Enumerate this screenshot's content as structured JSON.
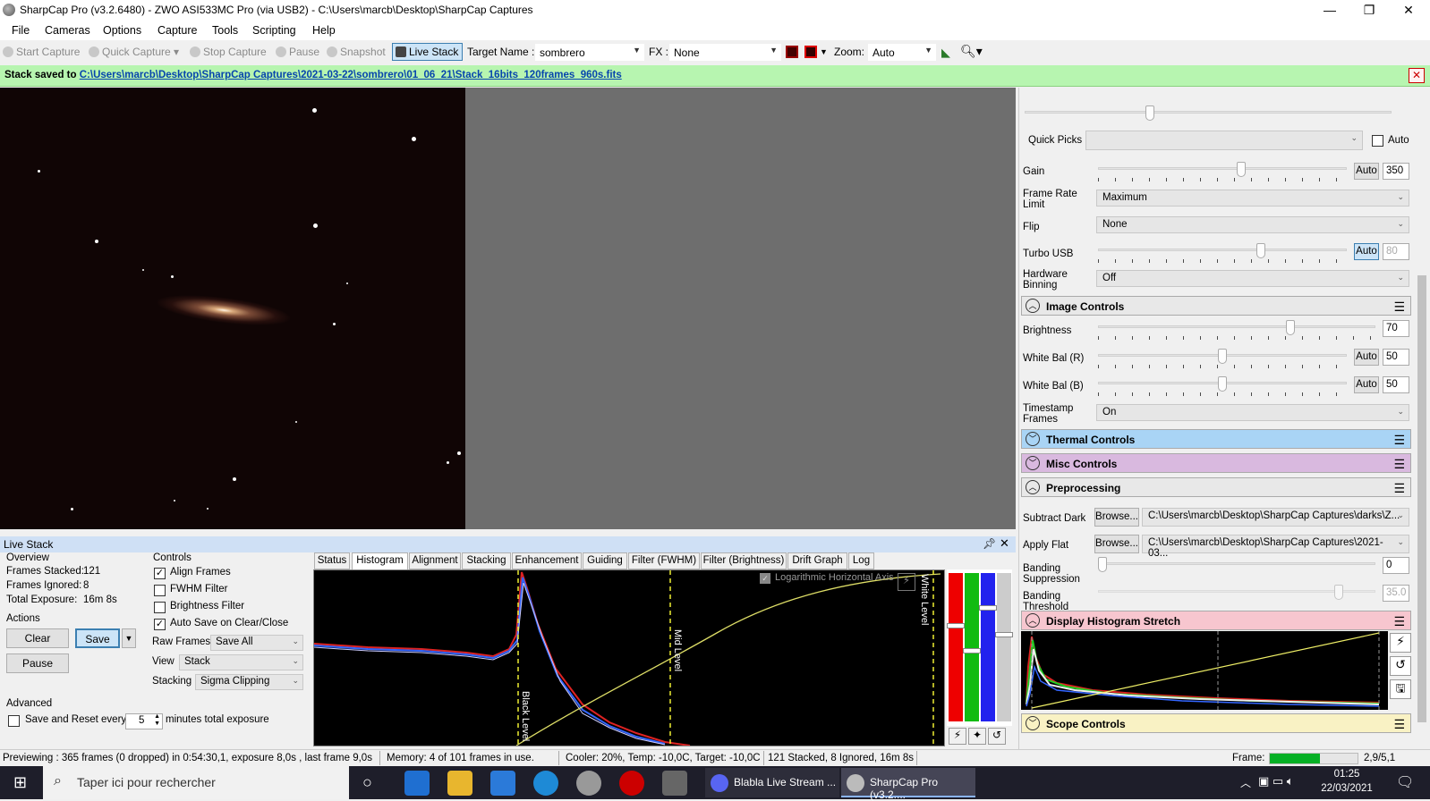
{
  "window": {
    "title": "SharpCap Pro (v3.2.6480) - ZWO ASI533MC Pro (via USB2) - C:\\Users\\marcb\\Desktop\\SharpCap Captures",
    "minimize": "—",
    "maximize": "❐",
    "close": "✕"
  },
  "menu": [
    "File",
    "Cameras",
    "Options",
    "Capture",
    "Tools",
    "Scripting",
    "Help"
  ],
  "toolbar": {
    "start_capture": "Start Capture",
    "quick_capture": "Quick Capture",
    "stop_capture": "Stop Capture",
    "pause": "Pause",
    "snapshot": "Snapshot",
    "live_stack": "Live Stack",
    "target_name_label": "Target Name :",
    "target_name_value": "sombrero",
    "fx_label": "FX :",
    "fx_value": "None",
    "zoom_label": "Zoom:",
    "zoom_value": "Auto"
  },
  "notification": {
    "prefix": "Stack saved to",
    "path": "C:\\Users\\marcb\\Desktop\\SharpCap Captures\\2021-03-22\\sombrero\\01_06_21\\Stack_16bits_120frames_960s.fits",
    "close": "✕"
  },
  "camera_controls": {
    "quick_picks_label": "Quick Picks",
    "quick_picks_value": "",
    "quick_picks_auto": "Auto",
    "gain_label": "Gain",
    "gain_auto": "Auto",
    "gain_value": "350",
    "gain_level": 0.58,
    "frame_rate_label": "Frame Rate Limit",
    "frame_rate_value": "Maximum",
    "flip_label": "Flip",
    "flip_value": "None",
    "turbo_label": "Turbo USB",
    "turbo_auto": "Auto",
    "turbo_value": "80",
    "turbo_level": 0.66,
    "binning_label": "Hardware Binning",
    "binning_value": "Off"
  },
  "image_controls": {
    "title": "Image Controls",
    "brightness_label": "Brightness",
    "brightness_value": "70",
    "brightness_level": 0.7,
    "wb_r_label": "White Bal (R)",
    "wb_r_auto": "Auto",
    "wb_r_value": "50",
    "wb_r_level": 0.5,
    "wb_b_label": "White Bal (B)",
    "wb_b_auto": "Auto",
    "wb_b_value": "50",
    "wb_b_level": 0.5,
    "timestamp_label": "Timestamp Frames",
    "timestamp_value": "On"
  },
  "sections": {
    "thermal": "Thermal Controls",
    "misc": "Misc Controls",
    "preprocessing": "Preprocessing",
    "display_stretch": "Display Histogram Stretch",
    "scope": "Scope Controls"
  },
  "preprocessing": {
    "subtract_dark_label": "Subtract Dark",
    "subtract_dark_browse": "Browse...",
    "subtract_dark_path": "C:\\Users\\marcb\\Desktop\\SharpCap Captures\\darks\\Z...",
    "apply_flat_label": "Apply Flat",
    "apply_flat_browse": "Browse...",
    "apply_flat_path": "C:\\Users\\marcb\\Desktop\\SharpCap Captures\\2021-03...",
    "banding_supp_label": "Banding Suppression",
    "banding_supp_value": "0",
    "banding_supp_level": 0.0,
    "banding_thresh_label": "Banding Threshold",
    "banding_thresh_value": "35.0",
    "banding_thresh_level": 0.88
  },
  "live_stack": {
    "title": "Live Stack",
    "overview_label": "Overview",
    "frames_stacked_label": "Frames Stacked:",
    "frames_stacked": "121",
    "frames_ignored_label": "Frames Ignored:",
    "frames_ignored": "8",
    "total_exposure_label": "Total Exposure:",
    "total_exposure": "16m 8s",
    "actions_label": "Actions",
    "clear": "Clear",
    "save": "Save",
    "pause": "Pause",
    "advanced_label": "Advanced",
    "save_reset_label": "Save and Reset every",
    "save_reset_value": "5",
    "save_reset_suffix": "minutes total exposure",
    "controls_label": "Controls",
    "align_frames": "Align Frames",
    "fwhm_filter": "FWHM Filter",
    "brightness_filter": "Brightness Filter",
    "auto_save": "Auto Save on Clear/Close",
    "raw_frames_label": "Raw Frames",
    "raw_frames_value": "Save All",
    "view_label": "View",
    "view_value": "Stack",
    "stacking_label": "Stacking",
    "stacking_value": "Sigma Clipping",
    "tabs": [
      "Status",
      "Histogram",
      "Alignment",
      "Stacking",
      "Enhancement",
      "Guiding",
      "Filter (FWHM)",
      "Filter (Brightness)",
      "Drift Graph",
      "Log"
    ],
    "active_tab": "Histogram",
    "log_axis_label": "Logarithmic Horizontal Axis",
    "black_level_label": "Black Level",
    "mid_level_label": "Mid Level",
    "white_level_label": "White Level"
  },
  "status": {
    "preview": "Previewing : 365 frames (0 dropped) in 0:54:30,1, exposure 8,0s , last frame 9,0s",
    "memory": "Memory: 4 of 101 frames in use.",
    "cooler": "Cooler: 20%, Temp: -10,0C, Target: -10,0C",
    "stacked": "121 Stacked, 8 Ignored, 16m 8s",
    "frame_label": "Frame:",
    "frame_value": "2,9/5,1",
    "frame_fraction": 0.57
  },
  "taskbar": {
    "search_placeholder": "Taper ici pour rechercher",
    "app1": "Blabla Live Stream ...",
    "app2": "SharpCap Pro (v3.2....",
    "time": "01:25",
    "date": "22/03/2021"
  },
  "colors": {
    "notify_bg": "#b7f5b0",
    "thermal": "#a9d4f5",
    "misc": "#d9b9df",
    "preprocessing": "#e8e8e8",
    "display_stretch": "#f7c6cf",
    "scope": "#f9f2c4",
    "active_tab": "#ffffff"
  }
}
